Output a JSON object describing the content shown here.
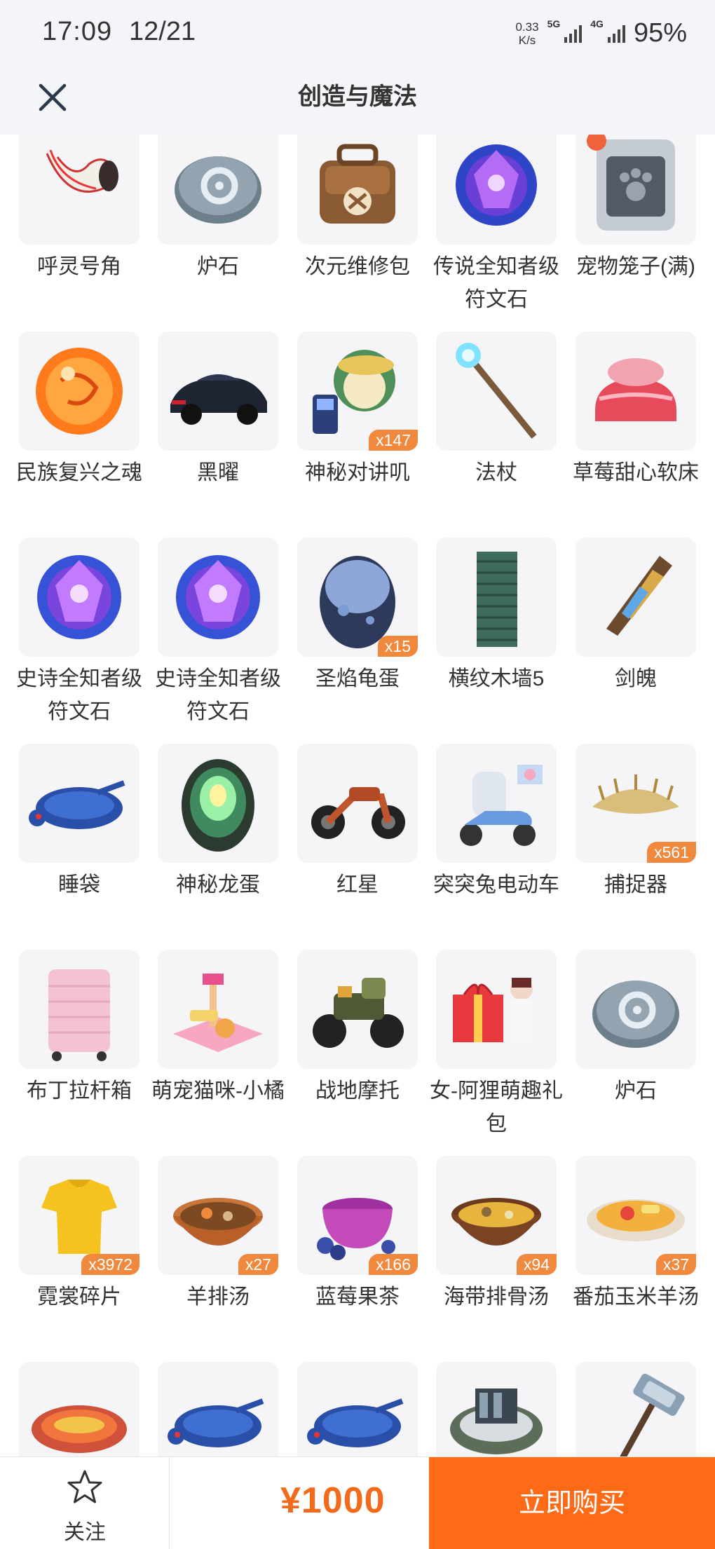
{
  "status_bar": {
    "time": "17:09",
    "date": "12/21",
    "net_speed_value": "0.33",
    "net_speed_unit": "K/s",
    "sim1_label": "5G",
    "sim2_label": "4G",
    "battery": "95%"
  },
  "nav": {
    "title": "创造与魔法",
    "close_icon": "close-icon"
  },
  "items": [
    [
      {
        "name": "呼灵号角",
        "icon": "horn",
        "qty": ""
      },
      {
        "name": "炉石",
        "icon": "stone",
        "qty": ""
      },
      {
        "name": "次元维修包",
        "icon": "bag",
        "qty": ""
      },
      {
        "name": "传说全知者级符文石",
        "icon": "rune-legend",
        "qty": ""
      },
      {
        "name": "宠物笼子(满)",
        "icon": "cage",
        "qty": ""
      }
    ],
    [
      {
        "name": "民族复兴之魂",
        "icon": "orb",
        "qty": ""
      },
      {
        "name": "黑曜",
        "icon": "car",
        "qty": ""
      },
      {
        "name": "神秘对讲叽",
        "icon": "walkie",
        "qty": "x147"
      },
      {
        "name": "法杖",
        "icon": "staff",
        "qty": ""
      },
      {
        "name": "草莓甜心软床",
        "icon": "bed",
        "qty": ""
      }
    ],
    [
      {
        "name": "史诗全知者级符文石",
        "icon": "rune-epic",
        "qty": ""
      },
      {
        "name": "史诗全知者级符文石",
        "icon": "rune-epic",
        "qty": ""
      },
      {
        "name": "圣焰龟蛋",
        "icon": "egg-blue",
        "qty": "x15"
      },
      {
        "name": "横纹木墙5",
        "icon": "wall",
        "qty": ""
      },
      {
        "name": "剑魄",
        "icon": "sword",
        "qty": ""
      }
    ],
    [
      {
        "name": "睡袋",
        "icon": "sleeping-bag",
        "qty": ""
      },
      {
        "name": "神秘龙蛋",
        "icon": "egg-dragon",
        "qty": ""
      },
      {
        "name": "红星",
        "icon": "motorbike",
        "qty": ""
      },
      {
        "name": "突突兔电动车",
        "icon": "scooter",
        "qty": ""
      },
      {
        "name": "捕捉器",
        "icon": "trap",
        "qty": "x561"
      }
    ],
    [
      {
        "name": "布丁拉杆箱",
        "icon": "suitcase",
        "qty": ""
      },
      {
        "name": "萌宠猫咪-小橘",
        "icon": "cat-tower",
        "qty": ""
      },
      {
        "name": "战地摩托",
        "icon": "war-bike",
        "qty": ""
      },
      {
        "name": "女-阿狸萌趣礼包",
        "icon": "gift",
        "qty": ""
      },
      {
        "name": "炉石",
        "icon": "stone",
        "qty": ""
      }
    ],
    [
      {
        "name": "霓裳碎片",
        "icon": "shirt",
        "qty": "x3972"
      },
      {
        "name": "羊排汤",
        "icon": "soup-lamb",
        "qty": "x27"
      },
      {
        "name": "蓝莓果茶",
        "icon": "tea",
        "qty": "x166"
      },
      {
        "name": "海带排骨汤",
        "icon": "soup-kelp",
        "qty": "x94"
      },
      {
        "name": "番茄玉米羊汤",
        "icon": "soup-tomato",
        "qty": "x37"
      }
    ],
    [
      {
        "name": "",
        "icon": "fish-dish",
        "qty": ""
      },
      {
        "name": "",
        "icon": "sleeping-bag",
        "qty": ""
      },
      {
        "name": "",
        "icon": "sleeping-bag",
        "qty": ""
      },
      {
        "name": "",
        "icon": "arena",
        "qty": ""
      },
      {
        "name": "",
        "icon": "hammer",
        "qty": ""
      }
    ]
  ],
  "bottom_bar": {
    "follow_label": "关注",
    "price": "¥1000",
    "buy_label": "立即购买"
  },
  "colors": {
    "accent": "#ff6a16",
    "price": "#f26a1b",
    "badge": "#f0883e",
    "header_bg": "#f3f5f8"
  }
}
